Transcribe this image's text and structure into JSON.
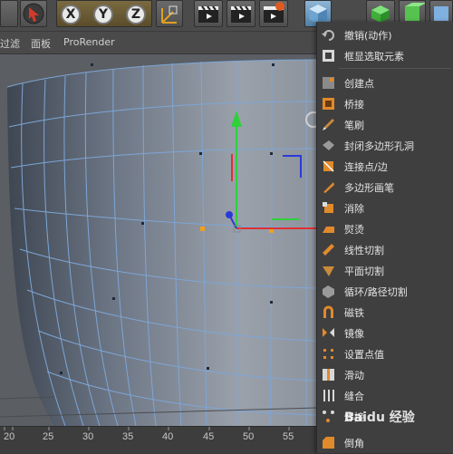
{
  "toolbar": {
    "axis_x": "X",
    "axis_y": "Y",
    "axis_z": "Z"
  },
  "menubar": {
    "items": [
      "过滤",
      "面板",
      "ProRender"
    ]
  },
  "ruler": {
    "ticks": [
      "20",
      "25",
      "30",
      "35",
      "40",
      "45",
      "50",
      "55"
    ]
  },
  "context_menu": {
    "items": [
      {
        "label": "撤销(动作)",
        "icon": "undo-icon",
        "color": "#bdbdbd"
      },
      {
        "label": "框显选取元素",
        "icon": "frame-selection-icon",
        "color": "#d8d8d8"
      },
      {
        "label": "创建点",
        "icon": "create-point-icon",
        "color": "#e08a2c"
      },
      {
        "label": "桥接",
        "icon": "bridge-icon",
        "color": "#e08a2c"
      },
      {
        "label": "笔刷",
        "icon": "brush-icon",
        "color": "#c98a3a"
      },
      {
        "label": "封闭多边形孔洞",
        "icon": "close-hole-icon",
        "color": "#9a9a9a"
      },
      {
        "label": "连接点/边",
        "icon": "connect-icon",
        "color": "#e08a2c"
      },
      {
        "label": "多边形画笔",
        "icon": "polygon-pen-icon",
        "color": "#e08a2c"
      },
      {
        "label": "消除",
        "icon": "dissolve-icon",
        "color": "#e08a2c"
      },
      {
        "label": "熨烫",
        "icon": "iron-icon",
        "color": "#e08a2c"
      },
      {
        "label": "线性切割",
        "icon": "line-cut-icon",
        "color": "#e08a2c"
      },
      {
        "label": "平面切割",
        "icon": "plane-cut-icon",
        "color": "#c98a3a"
      },
      {
        "label": "循环/路径切割",
        "icon": "loop-cut-icon",
        "color": "#9a9a9a"
      },
      {
        "label": "磁铁",
        "icon": "magnet-icon",
        "color": "#e08a2c"
      },
      {
        "label": "镜像",
        "icon": "mirror-icon",
        "color": "#d8d8d8"
      },
      {
        "label": "设置点值",
        "icon": "set-point-value-icon",
        "color": "#e08a2c"
      },
      {
        "label": "滑动",
        "icon": "slide-icon",
        "color": "#e08a2c"
      },
      {
        "label": "缝合",
        "icon": "stitch-icon",
        "color": "#d8d8d8"
      },
      {
        "label": "焊接",
        "icon": "weld-icon",
        "color": "#d8d8d8"
      },
      {
        "label": "倒角",
        "icon": "bevel-icon",
        "color": "#e08a2c"
      }
    ]
  },
  "watermark": {
    "text": "Baidu 经验"
  }
}
